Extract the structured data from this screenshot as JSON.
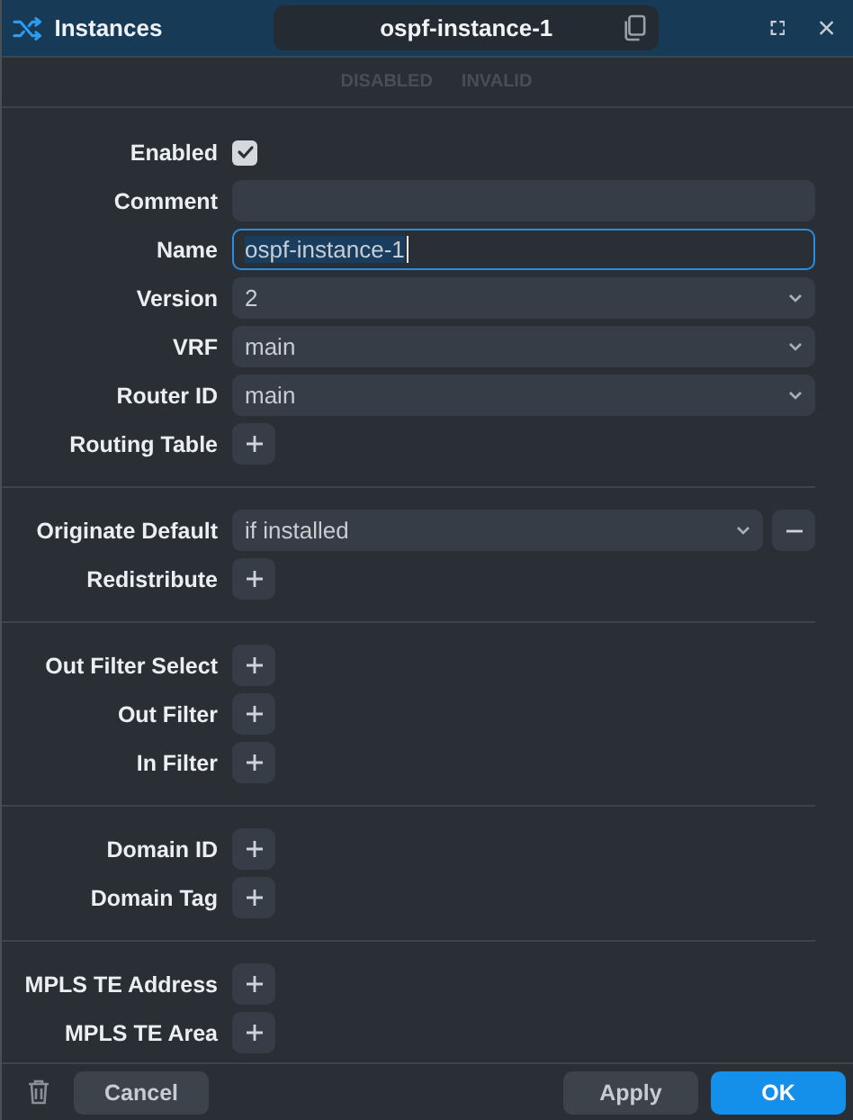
{
  "window": {
    "title": "Instances",
    "record_name": "ospf-instance-1"
  },
  "status_flags": [
    {
      "label": "DISABLED",
      "active": false
    },
    {
      "label": "INVALID",
      "active": false
    }
  ],
  "sections": [
    {
      "fields": [
        {
          "label": "Enabled",
          "kind": "checkbox",
          "checked": true
        },
        {
          "label": "Comment",
          "kind": "text"
        },
        {
          "label": "Name",
          "kind": "text",
          "value": "ospf-instance-1",
          "focused": true
        },
        {
          "label": "Version",
          "kind": "select",
          "value": "2"
        },
        {
          "label": "VRF",
          "kind": "select",
          "value": "main"
        },
        {
          "label": "Router ID",
          "kind": "select",
          "value": "main"
        },
        {
          "label": "Routing Table",
          "kind": "add"
        }
      ]
    },
    {
      "fields": [
        {
          "label": "Originate Default",
          "kind": "select",
          "value": "if installed",
          "removable": true
        },
        {
          "label": "Redistribute",
          "kind": "add"
        }
      ]
    },
    {
      "fields": [
        {
          "label": "Out Filter Select",
          "kind": "add"
        },
        {
          "label": "Out Filter",
          "kind": "add"
        },
        {
          "label": "In Filter",
          "kind": "add"
        }
      ]
    },
    {
      "fields": [
        {
          "label": "Domain ID",
          "kind": "add"
        },
        {
          "label": "Domain Tag",
          "kind": "add"
        }
      ]
    },
    {
      "fields": [
        {
          "label": "MPLS TE Address",
          "kind": "add"
        },
        {
          "label": "MPLS TE Area",
          "kind": "add"
        }
      ]
    }
  ],
  "footer": {
    "buttons": [
      {
        "label": "Cancel",
        "kind": "secondary"
      },
      {
        "label": "Apply",
        "kind": "secondary"
      },
      {
        "label": "OK",
        "kind": "primary"
      }
    ]
  }
}
